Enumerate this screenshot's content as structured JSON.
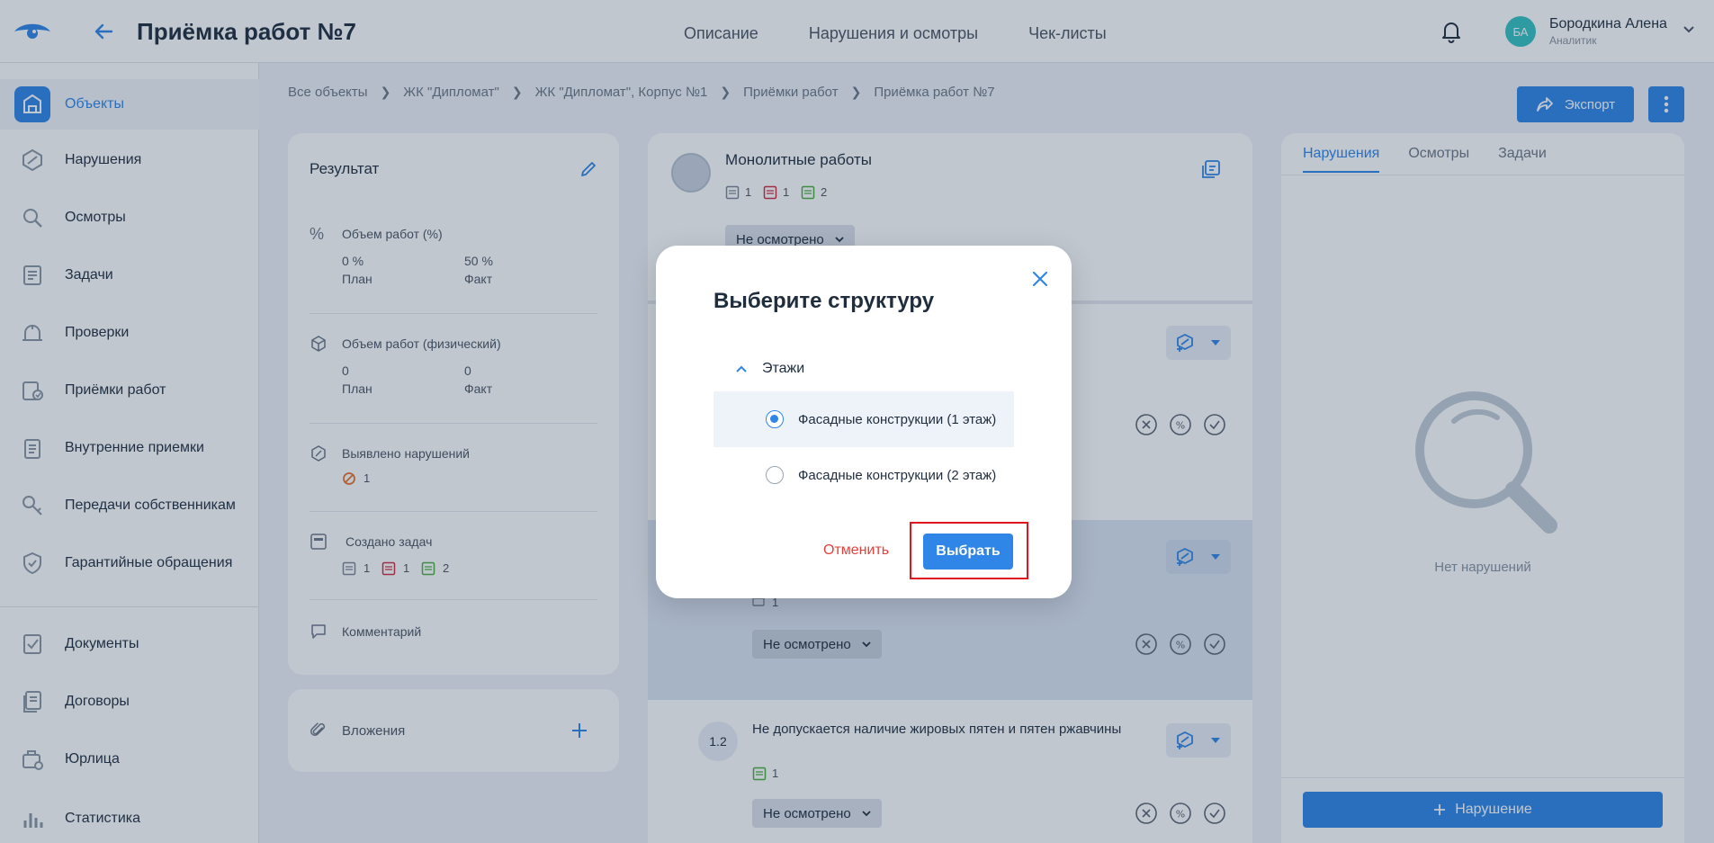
{
  "header": {
    "title": "Приёмка работ №7",
    "nav": [
      "Описание",
      "Нарушения и осмотры",
      "Чек-листы"
    ],
    "user": {
      "initials": "БА",
      "name": "Бородкина Алена",
      "role": "Аналитик"
    }
  },
  "sidebar": {
    "items": [
      {
        "label": "Объекты",
        "icon": "building-icon",
        "active": true
      },
      {
        "label": "Нарушения",
        "icon": "violation-icon"
      },
      {
        "label": "Осмотры",
        "icon": "search-icon"
      },
      {
        "label": "Задачи",
        "icon": "tasks-icon"
      },
      {
        "label": "Проверки",
        "icon": "inspection-icon"
      },
      {
        "label": "Приёмки работ",
        "icon": "acceptance-icon"
      },
      {
        "label": "Внутренние приемки",
        "icon": "clipboard-icon"
      },
      {
        "label": "Передачи собственникам",
        "icon": "key-icon"
      },
      {
        "label": "Гарантийные обращения",
        "icon": "shield-icon"
      },
      {
        "label": "Документы",
        "icon": "document-icon"
      },
      {
        "label": "Договоры",
        "icon": "contracts-icon"
      },
      {
        "label": "Юрлица",
        "icon": "legal-entity-icon"
      },
      {
        "label": "Статистика",
        "icon": "chart-icon"
      }
    ]
  },
  "breadcrumb": [
    "Все объекты",
    "ЖК \"Дипломат\"",
    "ЖК \"Дипломат\", Корпус №1",
    "Приёмки работ",
    "Приёмка работ №7"
  ],
  "toolbar": {
    "export_label": "Экспорт"
  },
  "result": {
    "title": "Результат",
    "volume_pct": {
      "label": "Объем работ (%)",
      "plan_value": "0 %",
      "plan_label": "План",
      "fact_value": "50 %",
      "fact_label": "Факт"
    },
    "volume_phys": {
      "label": "Объем работ (физический)",
      "plan_value": "0",
      "plan_label": "План",
      "fact_value": "0",
      "fact_label": "Факт"
    },
    "violations": {
      "label": "Выявлено нарушений",
      "count": "1"
    },
    "tasks": {
      "label": "Создано задач",
      "gray": "1",
      "red": "1",
      "green": "2"
    },
    "comment_label": "Комментарий"
  },
  "attachments": {
    "label": "Вложения"
  },
  "checklist": {
    "section_title": "Монолитные работы",
    "counts": {
      "gray": "1",
      "red": "1",
      "green": "2"
    },
    "status": "Не осмотрено",
    "row_status": "Не осмотрено",
    "row3_status": "Не осмотрено",
    "row2_count": "1",
    "item": {
      "number": "1.2",
      "text": "Не допускается наличие жировых пятен и пятен ржавчины",
      "count": "1",
      "status": "Не осмотрено"
    }
  },
  "right_panel": {
    "tabs": [
      "Нарушения",
      "Осмотры",
      "Задачи"
    ],
    "active_tab": 0,
    "empty_text": "Нет нарушений",
    "add_label": "Нарушение"
  },
  "modal": {
    "title": "Выберите структуру",
    "group": "Этажи",
    "options": [
      {
        "label": "Фасадные конструкции (1 этаж)",
        "selected": true
      },
      {
        "label": "Фасадные конструкции (2 этаж)",
        "selected": false
      }
    ],
    "cancel_label": "Отменить",
    "confirm_label": "Выбрать"
  },
  "colors": {
    "accent": "#2f86e6",
    "danger": "#e2413b",
    "highlight": "#e0161c"
  }
}
